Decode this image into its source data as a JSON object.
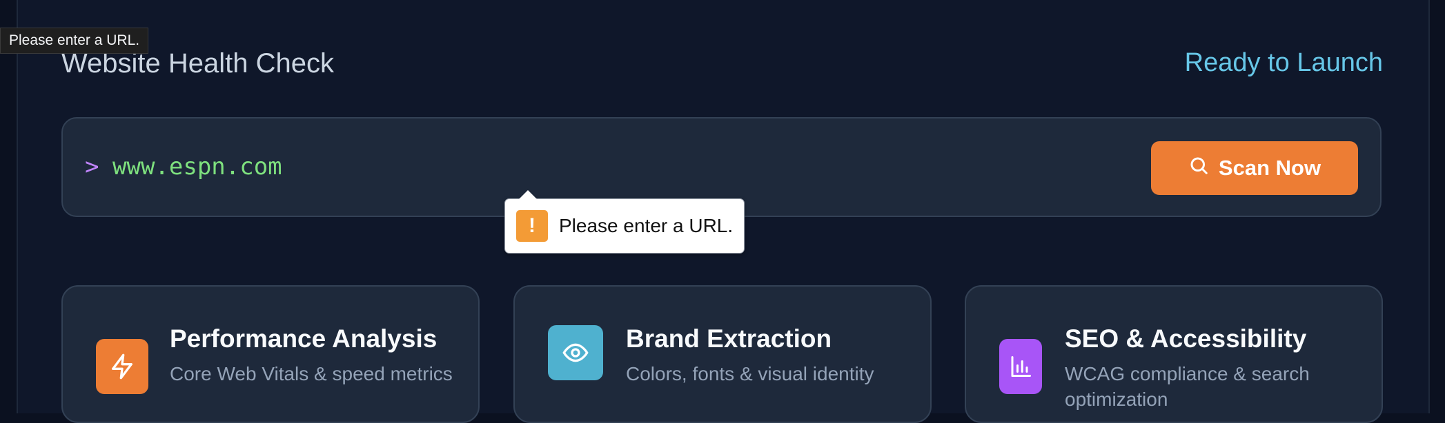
{
  "tooltip": {
    "text": "Please enter a URL."
  },
  "header": {
    "title": "Website Health Check",
    "status": "Ready to Launch"
  },
  "scanner": {
    "prompt_symbol": ">",
    "url_value": "www.espn.com",
    "scan_button_label": "Scan Now",
    "scan_icon": "search-icon"
  },
  "validation": {
    "message": "Please enter a URL.",
    "icon": "warning-icon"
  },
  "features": [
    {
      "title": "Performance Analysis",
      "description": "Core Web Vitals & speed metrics",
      "icon": "lightning-icon",
      "color": "#ed7d34"
    },
    {
      "title": "Brand Extraction",
      "description": "Colors, fonts & visual identity",
      "icon": "eye-icon",
      "color": "#4fb1cf"
    },
    {
      "title": "SEO & Accessibility",
      "description": "WCAG compliance & search optimization",
      "icon": "bar-chart-icon",
      "color": "#a855f7"
    }
  ],
  "colors": {
    "background": "#0f172a",
    "panel": "#1e293b",
    "accent_orange": "#ed7d34",
    "accent_cyan": "#67c7e8",
    "accent_purple": "#a855f7",
    "url_green": "#7ee07e"
  }
}
